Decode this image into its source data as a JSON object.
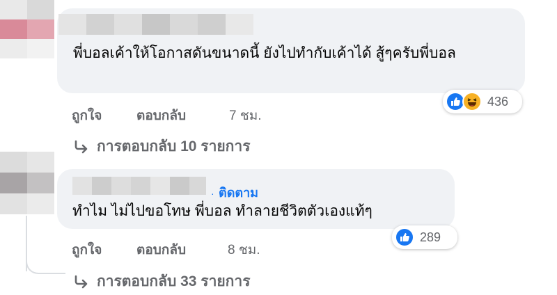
{
  "comments": [
    {
      "text": "พี่บอลเค้าให้โอกาสดันขนาดนี้ ยังไปทำกับเค้าได้ สู้ๆครับพี่บอล",
      "reaction_count": "436",
      "reactions": [
        "like-icon",
        "haha-icon"
      ],
      "like_label": "ถูกใจ",
      "reply_label": "ตอบกลับ",
      "time": "7 ชม.",
      "replies_label": "การตอบกลับ 10 รายการ"
    },
    {
      "follow_label": "ติดตาม",
      "text": "ทำไม ไม่ไปขอโทษ พี่บอล ทำลายชีวิตตัวเองแท้ๆ",
      "reaction_count": "289",
      "reactions": [
        "like-icon"
      ],
      "like_label": "ถูกใจ",
      "reply_label": "ตอบกลับ",
      "time": "8 ชม.",
      "replies_label": "การตอบกลับ 33 รายการ"
    }
  ],
  "colors": {
    "bubble": "#f0f2f5",
    "link_blue": "#1877f2",
    "secondary_text": "#65676b",
    "haha_yellow": "#f7b125"
  }
}
